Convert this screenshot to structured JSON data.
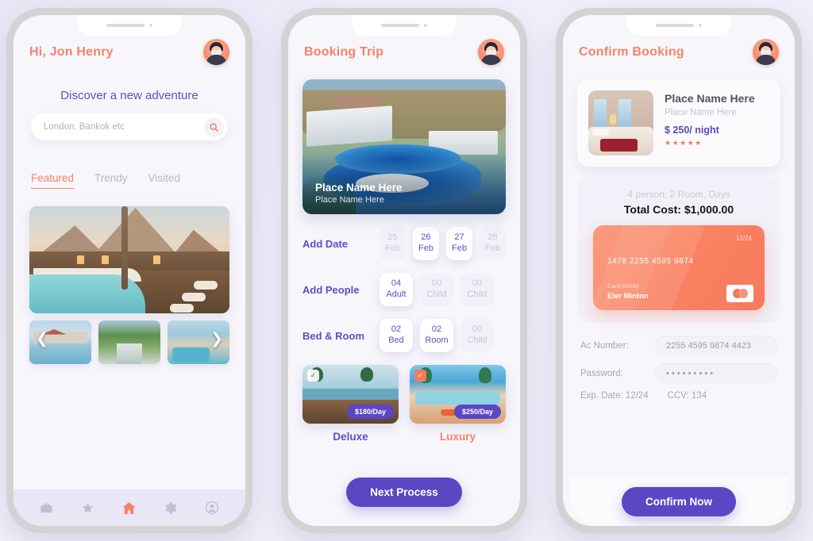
{
  "app": {
    "accent_orange": "#f58368",
    "accent_purple": "#5b46c4",
    "screen_bg": "#f7f6fb",
    "page_bg": "#eceaf7"
  },
  "phone1": {
    "greeting": "Hi, Jon Henry",
    "avatar_name": "user-avatar",
    "discover_title": "Discover a new adventure",
    "search": {
      "placeholder": "London, Bankok etc",
      "value": "",
      "icon": "search-icon"
    },
    "tabs": [
      {
        "label": "Featured",
        "active": true
      },
      {
        "label": "Trendy",
        "active": false
      },
      {
        "label": "Visited",
        "active": false
      }
    ],
    "hero_image_alt": "tropical-resort-pool-at-dusk",
    "carousel": {
      "prev_icon": "chevron-left-icon",
      "next_icon": "chevron-right-icon",
      "thumbs": [
        "resort-villas-pool",
        "river-forest-landscape",
        "beach-resort-aerial"
      ]
    },
    "bottom_nav": [
      {
        "icon": "briefcase-icon",
        "active": false
      },
      {
        "icon": "star-icon",
        "active": false
      },
      {
        "icon": "home-icon",
        "active": true
      },
      {
        "icon": "gear-icon",
        "active": false
      },
      {
        "icon": "profile-icon",
        "active": false
      }
    ]
  },
  "phone2": {
    "title": "Booking Trip",
    "hero": {
      "image_alt": "large-blue-resort-pool",
      "place_title": "Place Name Here",
      "place_subtitle": "Place Name Here"
    },
    "add_date": {
      "label": "Add Date",
      "options": [
        {
          "num": "25",
          "unit": "Feb",
          "active": false
        },
        {
          "num": "26",
          "unit": "Feb",
          "active": true
        },
        {
          "num": "27",
          "unit": "Feb",
          "active": true
        },
        {
          "num": "28",
          "unit": "Feb",
          "active": false
        }
      ]
    },
    "add_people": {
      "label": "Add People",
      "options": [
        {
          "num": "04",
          "unit": "Adult",
          "active": true
        },
        {
          "num": "00",
          "unit": "Child",
          "active": false
        },
        {
          "num": "00",
          "unit": "Child",
          "active": false
        }
      ]
    },
    "bed_room": {
      "label": "Bed & Room",
      "options": [
        {
          "num": "02",
          "unit": "Bed",
          "active": true
        },
        {
          "num": "02",
          "unit": "Room",
          "active": true
        },
        {
          "num": "00",
          "unit": "Child",
          "active": false
        }
      ]
    },
    "hotels": [
      {
        "name": "Deluxe",
        "price": "$180/Day",
        "selected": false,
        "check_icon": "check-icon",
        "image_alt": "beach-deck-loungers-sunset"
      },
      {
        "name": "Luxury",
        "price": "$250/Day",
        "selected": true,
        "check_icon": "check-icon",
        "image_alt": "luxury-pool-palms"
      }
    ],
    "next_button": "Next Process"
  },
  "phone3": {
    "title": "Confirm Booking",
    "room": {
      "image_alt": "hotel-room-bed-red-throw",
      "name": "Place Name Here",
      "subtitle": "Place Name Here",
      "price": "$ 250/ night",
      "stars": "★★★★★"
    },
    "summary": {
      "details": "4 person, 2 Room, Days",
      "total": "Total Cost: $1,000.00"
    },
    "credit_card": {
      "number": "1478 2255 4595 9874",
      "expiry": "12/24",
      "holder_label": "Card Holder",
      "holder_name": "Eler Minton",
      "brand_icon": "mastercard-icon"
    },
    "form": {
      "ac_number_label": "Ac Number:",
      "ac_number_value": "2255 4595 9874 4423",
      "password_label": "Password:",
      "password_value": "• • • • • • • • •",
      "exp_date": "Exp. Date: 12/24",
      "ccv": "CCV: 134"
    },
    "confirm_button": "Confirm Now"
  }
}
